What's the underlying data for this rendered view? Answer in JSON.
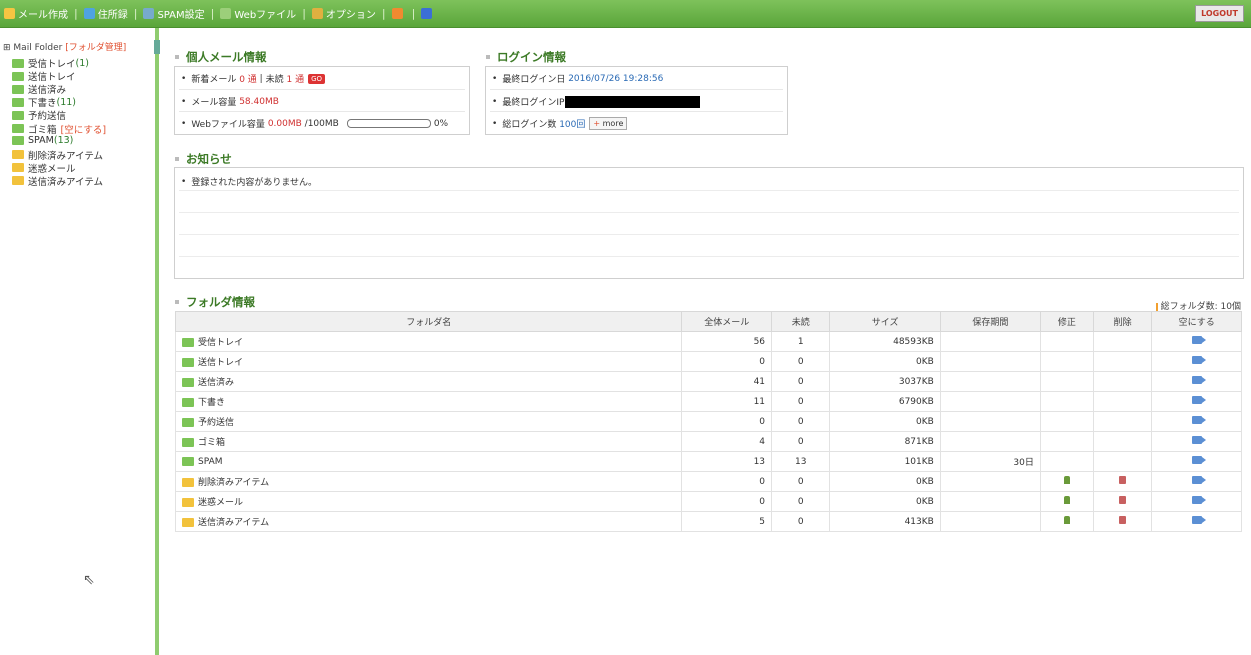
{
  "topbar": {
    "menu": [
      {
        "label": "メール作成",
        "icon": "compose-icon",
        "color": "#f5c542"
      },
      {
        "label": "住所録",
        "icon": "address-book-icon",
        "color": "#4fa3e0"
      },
      {
        "label": "SPAM設定",
        "icon": "spam-settings-icon",
        "color": "#7ac"
      },
      {
        "label": "Webファイル",
        "icon": "webfile-icon",
        "color": "#9ccf7a"
      },
      {
        "label": "オプション",
        "icon": "option-icon",
        "color": "#e0b040"
      },
      {
        "label": "",
        "icon": "home-icon",
        "color": "#f08a30"
      },
      {
        "label": "",
        "icon": "help-icon",
        "color": "#3b6fd6"
      }
    ],
    "logout_label": "LOGOUT"
  },
  "sidebar": {
    "root_label": "Mail Folder",
    "root_manage": "[フォルダ管理]",
    "items": [
      {
        "label": "受信トレイ",
        "count": "(1)",
        "color": "green"
      },
      {
        "label": "送信トレイ",
        "count": "",
        "color": "green"
      },
      {
        "label": "送信済み",
        "count": "",
        "color": "green"
      },
      {
        "label": "下書き",
        "count": "(11)",
        "color": "green"
      },
      {
        "label": "予約送信",
        "count": "",
        "color": "green"
      },
      {
        "label": "ゴミ箱",
        "count": "",
        "empty": "[空にする]",
        "color": "green"
      },
      {
        "label": "SPAM",
        "count": "(13)",
        "color": "green"
      },
      {
        "label": "削除済みアイテム",
        "count": "",
        "color": "yellow"
      },
      {
        "label": "迷惑メール",
        "count": "",
        "color": "yellow"
      },
      {
        "label": "送信済みアイテム",
        "count": "",
        "color": "yellow"
      }
    ]
  },
  "personal": {
    "title": "個人メール情報",
    "new_label": "新着メール",
    "new_value": "0 通",
    "sep": "|",
    "unread_label": "未読",
    "unread_value": "1 通",
    "badge": "GO",
    "capacity_label": "メール容量",
    "capacity_value": "58.40MB",
    "webfile_label": "Webファイル容量",
    "webfile_value": "0.00MB",
    "webfile_total": "/100MB",
    "webfile_percent_text": "0%",
    "webfile_fraction": 0
  },
  "login": {
    "title": "ログイン情報",
    "last_date_label": "最終ログイン日",
    "last_date_value": "2016/07/26 19:28:56",
    "last_ip_label": "最終ログインIP",
    "count_label": "総ログイン数",
    "count_value": "100回",
    "more_label": "more"
  },
  "notice": {
    "title": "お知らせ",
    "empty_text": "登録された内容がありません。"
  },
  "folders": {
    "title": "フォルダ情報",
    "total": "総フォルダ数: 10個",
    "headers": [
      "フォルダ名",
      "全体メール",
      "未読",
      "サイズ",
      "保存期間",
      "修正",
      "削除",
      "空にする"
    ],
    "rows": [
      {
        "name": "受信トレイ",
        "total": "56",
        "unread": "1",
        "size": "48593KB",
        "period": "",
        "edit": false,
        "del": false,
        "color": "green"
      },
      {
        "name": "送信トレイ",
        "total": "0",
        "unread": "0",
        "size": "0KB",
        "period": "",
        "edit": false,
        "del": false,
        "color": "green"
      },
      {
        "name": "送信済み",
        "total": "41",
        "unread": "0",
        "size": "3037KB",
        "period": "",
        "edit": false,
        "del": false,
        "color": "green"
      },
      {
        "name": "下書き",
        "total": "11",
        "unread": "0",
        "size": "6790KB",
        "period": "",
        "edit": false,
        "del": false,
        "color": "green"
      },
      {
        "name": "予約送信",
        "total": "0",
        "unread": "0",
        "size": "0KB",
        "period": "",
        "edit": false,
        "del": false,
        "color": "green"
      },
      {
        "name": "ゴミ箱",
        "total": "4",
        "unread": "0",
        "size": "871KB",
        "period": "",
        "edit": false,
        "del": false,
        "color": "green"
      },
      {
        "name": "SPAM",
        "total": "13",
        "unread": "13",
        "size": "101KB",
        "period": "30日",
        "edit": false,
        "del": false,
        "color": "green"
      },
      {
        "name": "削除済みアイテム",
        "total": "0",
        "unread": "0",
        "size": "0KB",
        "period": "",
        "edit": true,
        "del": true,
        "color": "yellow"
      },
      {
        "name": "迷惑メール",
        "total": "0",
        "unread": "0",
        "size": "0KB",
        "period": "",
        "edit": true,
        "del": true,
        "color": "yellow"
      },
      {
        "name": "送信済みアイテム",
        "total": "5",
        "unread": "0",
        "size": "413KB",
        "period": "",
        "edit": true,
        "del": true,
        "color": "yellow"
      }
    ]
  },
  "cursor_glyph": "⇖"
}
